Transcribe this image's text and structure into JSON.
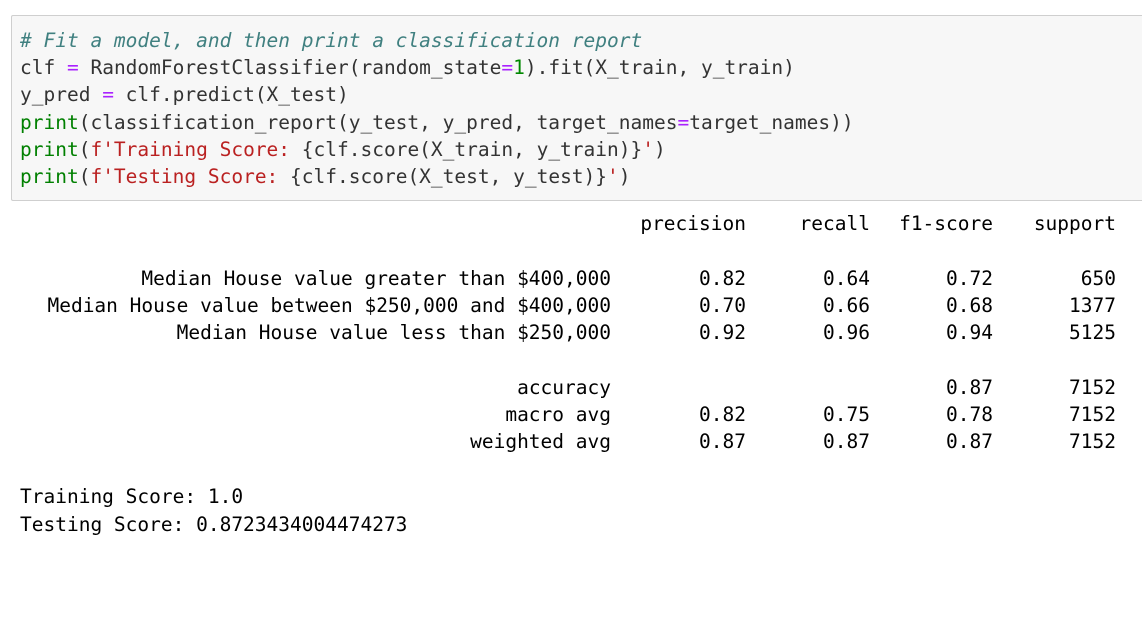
{
  "code_cell": {
    "lines": [
      [
        {
          "t": "# Fit a model, and then print a classification report",
          "c": "cm"
        }
      ],
      [
        {
          "t": "clf ",
          "c": "default"
        },
        {
          "t": "=",
          "c": "op"
        },
        {
          "t": " RandomForestClassifier(random_state",
          "c": "default"
        },
        {
          "t": "=",
          "c": "op"
        },
        {
          "t": "1",
          "c": "num"
        },
        {
          "t": ").fit(X_train, y_train)",
          "c": "default"
        }
      ],
      [
        {
          "t": "y_pred ",
          "c": "default"
        },
        {
          "t": "=",
          "c": "op"
        },
        {
          "t": " clf.predict(X_test)",
          "c": "default"
        }
      ],
      [
        {
          "t": "print",
          "c": "kw"
        },
        {
          "t": "(classification_report(y_test, y_pred, target_names",
          "c": "default"
        },
        {
          "t": "=",
          "c": "op"
        },
        {
          "t": "target_names))",
          "c": "default"
        }
      ],
      [
        {
          "t": "print",
          "c": "kw"
        },
        {
          "t": "(",
          "c": "default"
        },
        {
          "t": "f'Training Score: ",
          "c": "str"
        },
        {
          "t": "{clf.score(X_train, y_train)}",
          "c": "default"
        },
        {
          "t": "'",
          "c": "str"
        },
        {
          "t": ")",
          "c": "default"
        }
      ],
      [
        {
          "t": "print",
          "c": "kw"
        },
        {
          "t": "(",
          "c": "default"
        },
        {
          "t": "f'Testing Score: ",
          "c": "str"
        },
        {
          "t": "{clf.score(X_test, y_test)}",
          "c": "default"
        },
        {
          "t": "'",
          "c": "str"
        },
        {
          "t": ")",
          "c": "default"
        }
      ]
    ]
  },
  "report": {
    "headers": {
      "precision": "precision",
      "recall": "recall",
      "f1": "f1-score",
      "support": "support"
    },
    "classes": [
      {
        "label": "Median House value greater than $400,000",
        "precision": "0.82",
        "recall": "0.64",
        "f1": "0.72",
        "support": "650"
      },
      {
        "label": "Median House value between $250,000 and $400,000",
        "precision": "0.70",
        "recall": "0.66",
        "f1": "0.68",
        "support": "1377"
      },
      {
        "label": "Median House value less than $250,000",
        "precision": "0.92",
        "recall": "0.96",
        "f1": "0.94",
        "support": "5125"
      }
    ],
    "accuracy": {
      "label": "accuracy",
      "f1": "0.87",
      "support": "7152"
    },
    "macro": {
      "label": "macro avg",
      "precision": "0.82",
      "recall": "0.75",
      "f1": "0.78",
      "support": "7152"
    },
    "weighted": {
      "label": "weighted avg",
      "precision": "0.87",
      "recall": "0.87",
      "f1": "0.87",
      "support": "7152"
    }
  },
  "scores": {
    "training": "Training Score: 1.0",
    "testing": "Testing Score: 0.8723434004474273"
  }
}
